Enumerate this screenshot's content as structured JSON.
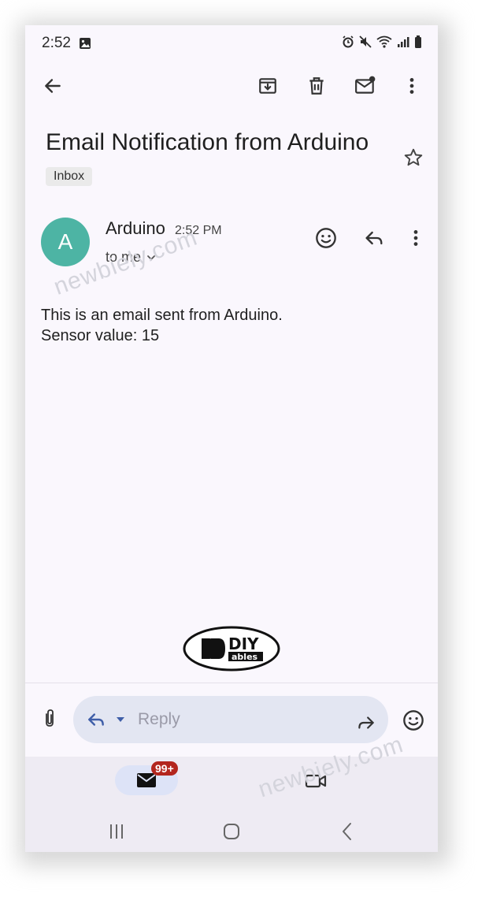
{
  "status_bar": {
    "time": "2:52",
    "icons": [
      "image-icon",
      "alarm-icon",
      "mute-icon",
      "wifi-icon",
      "signal-icon",
      "battery-icon"
    ]
  },
  "toolbar": {
    "icons": [
      "back-arrow-icon",
      "archive-icon",
      "trash-icon",
      "mark-unread-icon",
      "more-vert-icon"
    ]
  },
  "email": {
    "subject": "Email Notification from Arduino",
    "label": "Inbox",
    "sender": {
      "avatar_letter": "A",
      "avatar_color": "#4db4a4",
      "name": "Arduino",
      "time": "2:52 PM",
      "recipient": "to me"
    },
    "body_lines": [
      "This is an email sent from Arduino.",
      "Sensor value: 15"
    ]
  },
  "watermark": "newbiely.com",
  "logo": {
    "text_top": "DIY",
    "text_bottom": "ables"
  },
  "reply_bar": {
    "placeholder": "Reply"
  },
  "bottom_nav": {
    "mail_badge": "99+",
    "items": [
      "mail-icon",
      "meet-video-icon"
    ]
  },
  "system_nav": {
    "items": [
      "recents-icon",
      "home-icon",
      "back-icon"
    ]
  },
  "colors": {
    "background": "#faf7fd",
    "reply_box": "#e3e6f2",
    "badge": "#b3261e",
    "accent": "#3f5ea8"
  }
}
